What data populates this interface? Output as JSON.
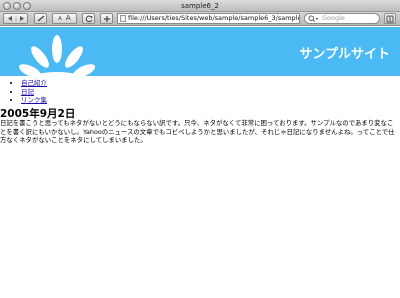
{
  "window": {
    "title": "sample6_2"
  },
  "toolbar": {
    "text_small": "A",
    "text_large": "A",
    "address": "file:///Users/ties/Sites/web/sample/sample6_3/sample",
    "search_placeholder": "Google"
  },
  "page": {
    "site_title": "サンプルサイト",
    "nav": [
      {
        "label": "自己紹介"
      },
      {
        "label": "日記"
      },
      {
        "label": "リンク集"
      }
    ],
    "entry_date": "2005年9月2日",
    "entry_body": "日記を書こうと思ってもネタがないとどうにもならない訳です。只今、ネタがなくて非常に困っております。サンプルなのであまり変なことを書く訳にもいかないし。Yahooのニュースの文章でもコピペしようかと思いましたが、それじゃ日記になりませんよね。ってことで仕方なくネタがないことをネタにしてしまいました。"
  },
  "colors": {
    "header_bg": "#4ab9f4",
    "site_title": "#ffffff",
    "link": "#1a0dab"
  }
}
